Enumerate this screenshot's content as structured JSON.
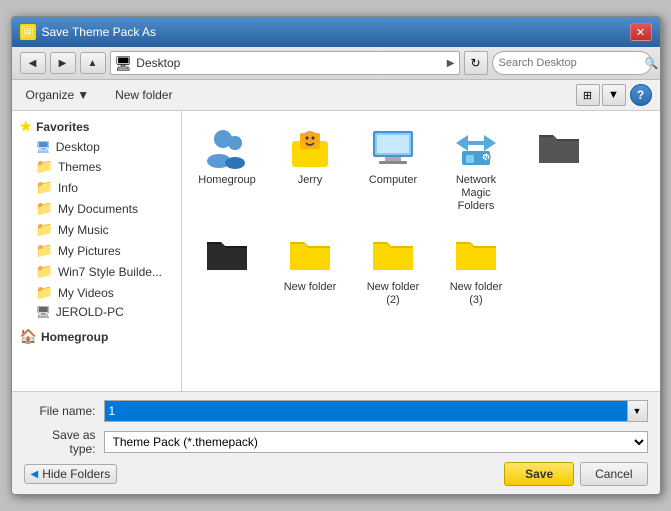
{
  "dialog": {
    "title": "Save Theme Pack As",
    "close_label": "✕"
  },
  "toolbar": {
    "address_label": "Desktop",
    "address_arrow": "▶",
    "search_placeholder": "Search Desktop",
    "refresh_icon": "↻",
    "back_icon": "◀",
    "forward_icon": "▶"
  },
  "toolbar2": {
    "organize_label": "Organize",
    "new_folder_label": "New folder",
    "help_label": "?"
  },
  "sidebar": {
    "favorites_label": "Favorites",
    "items": [
      {
        "id": "desktop",
        "label": "Desktop",
        "icon": "desktop"
      },
      {
        "id": "themes",
        "label": "Themes",
        "icon": "folder"
      },
      {
        "id": "info",
        "label": "Info",
        "icon": "folder"
      },
      {
        "id": "my-documents",
        "label": "My Documents",
        "icon": "folder"
      },
      {
        "id": "my-music",
        "label": "My Music",
        "icon": "folder"
      },
      {
        "id": "my-pictures",
        "label": "My Pictures",
        "icon": "folder"
      },
      {
        "id": "win7-style",
        "label": "Win7 Style Builde...",
        "icon": "folder"
      },
      {
        "id": "my-videos",
        "label": "My Videos",
        "icon": "folder"
      },
      {
        "id": "jerold-pc",
        "label": "JEROLD-PC",
        "icon": "computer"
      }
    ],
    "homegroup_label": "Homegroup"
  },
  "files": [
    {
      "id": "homegroup",
      "label": "Homegroup",
      "type": "homegroup"
    },
    {
      "id": "jerry",
      "label": "Jerry",
      "type": "user"
    },
    {
      "id": "computer",
      "label": "Computer",
      "type": "computer"
    },
    {
      "id": "network-magic",
      "label": "Network Magic Folders",
      "type": "folder-special"
    },
    {
      "id": "dark-folder1",
      "label": "",
      "type": "dark-folder"
    },
    {
      "id": "dark-folder2",
      "label": "",
      "type": "dark-folder2"
    },
    {
      "id": "new-folder1",
      "label": "New folder",
      "type": "folder"
    },
    {
      "id": "new-folder2",
      "label": "New folder (2)",
      "type": "folder"
    },
    {
      "id": "new-folder3",
      "label": "New folder (3)",
      "type": "folder"
    }
  ],
  "form": {
    "filename_label": "File name:",
    "filename_value": "1",
    "filetype_label": "Save as type:",
    "filetype_value": "Theme Pack (*.themepack)"
  },
  "buttons": {
    "hide_folders_label": "Hide Folders",
    "save_label": "Save",
    "cancel_label": "Cancel"
  }
}
